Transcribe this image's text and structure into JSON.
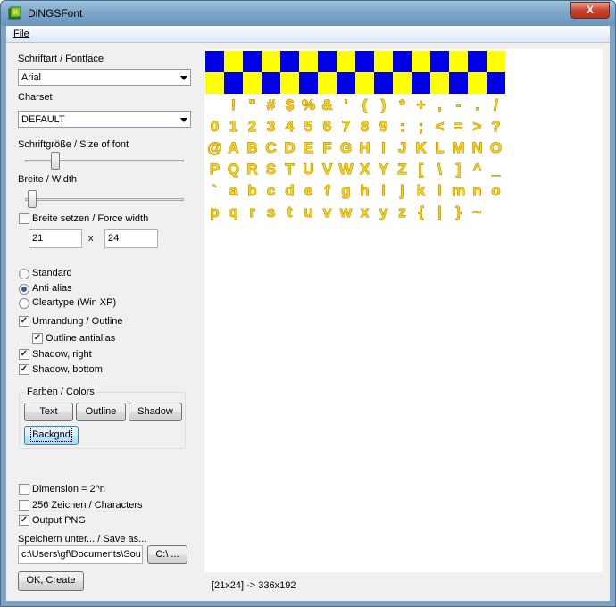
{
  "window": {
    "title": "DiNGSFont",
    "close_glyph": "X"
  },
  "menu": {
    "file": "File"
  },
  "form": {
    "fontface_label": "Schriftart / Fontface",
    "fontface_value": "Arial",
    "charset_label": "Charset",
    "charset_value": "DEFAULT",
    "size_label": "Schriftgröße / Size of font",
    "size_slider_fraction": 0.17,
    "width_label": "Breite / Width",
    "width_slider_fraction": 0.02,
    "force_width_label": "Breite setzen / Force width",
    "force_width_checked": false,
    "width_value": "21",
    "times_symbol": "x",
    "height_value": "24",
    "render_modes": [
      {
        "label": "Standard",
        "selected": false
      },
      {
        "label": "Anti alias",
        "selected": true
      },
      {
        "label": "Cleartype (Win XP)",
        "selected": false
      }
    ],
    "outline_label": "Umrandung / Outline",
    "outline_checked": true,
    "outline_aa_label": "Outline antialias",
    "outline_aa_checked": true,
    "shadow_right_label": "Shadow, right",
    "shadow_right_checked": true,
    "shadow_bottom_label": "Shadow, bottom",
    "shadow_bottom_checked": true,
    "colors_group_label": "Farben / Colors",
    "text_btn": "Text",
    "outline_btn": "Outline",
    "shadow_btn": "Shadow",
    "backgnd_btn": "Backgnd",
    "dimension_label": "Dimension = 2^n",
    "dimension_checked": false,
    "chars256_label": "256 Zeichen / Characters",
    "chars256_checked": false,
    "output_png_label": "Output PNG",
    "output_png_checked": true,
    "save_label": "Speichern unter... / Save as...",
    "save_path": "c:\\Users\\gf\\Documents\\Sou",
    "browse_btn": "C:\\ ...",
    "create_btn": "OK, Create"
  },
  "preview": {
    "colors": {
      "blue": "#0000e6",
      "yellow": "#ffff00",
      "glyph_fill": "#ffd200",
      "glyph_outline": "#7a5a00"
    },
    "checker_rows": [
      [
        "blue",
        "yellow",
        "blue",
        "yellow",
        "blue",
        "yellow",
        "blue",
        "yellow",
        "blue",
        "yellow",
        "blue",
        "yellow",
        "blue",
        "yellow",
        "blue",
        "yellow"
      ],
      [
        "yellow",
        "blue",
        "yellow",
        "blue",
        "yellow",
        "blue",
        "yellow",
        "blue",
        "yellow",
        "blue",
        "yellow",
        "blue",
        "yellow",
        "blue",
        "yellow",
        "blue"
      ]
    ],
    "glyph_rows": [
      [
        " ",
        "!",
        "\"",
        "#",
        "$",
        "%",
        "&",
        "'",
        "(",
        ")",
        "*",
        "+",
        ",",
        "-",
        ".",
        "/"
      ],
      [
        "0",
        "1",
        "2",
        "3",
        "4",
        "5",
        "6",
        "7",
        "8",
        "9",
        ":",
        ";",
        "<",
        "=",
        ">",
        "?"
      ],
      [
        "@",
        "A",
        "B",
        "C",
        "D",
        "E",
        "F",
        "G",
        "H",
        "I",
        "J",
        "K",
        "L",
        "M",
        "N",
        "O"
      ],
      [
        "P",
        "Q",
        "R",
        "S",
        "T",
        "U",
        "V",
        "W",
        "X",
        "Y",
        "Z",
        "[",
        "\\",
        "]",
        "^",
        "_"
      ],
      [
        "`",
        "a",
        "b",
        "c",
        "d",
        "e",
        "f",
        "g",
        "h",
        "i",
        "j",
        "k",
        "l",
        "m",
        "n",
        "o"
      ],
      [
        "p",
        "q",
        "r",
        "s",
        "t",
        "u",
        "v",
        "w",
        "x",
        "y",
        "z",
        "{",
        "|",
        "}",
        "~",
        ""
      ]
    ]
  },
  "status": "[21x24] -> 336x192"
}
